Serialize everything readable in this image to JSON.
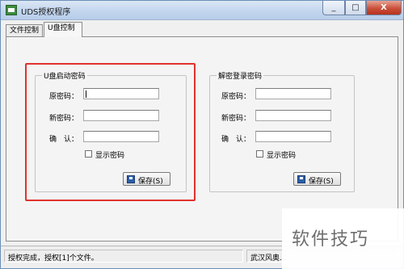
{
  "window": {
    "title": "UDS授权程序",
    "buttons": {
      "minimize": "_",
      "maximize": "□",
      "close": "X"
    }
  },
  "tabs": [
    {
      "label": "文件控制",
      "active": false
    },
    {
      "label": "U盘控制",
      "active": true
    }
  ],
  "usb_boot_password": {
    "title": "U盘启动密码",
    "old_label": "原密码：",
    "new_label": "新密码：",
    "confirm_label": "确　认：",
    "old_value": "",
    "new_value": "",
    "confirm_value": "",
    "show_password_label": "显示密码",
    "show_password_checked": false,
    "save_label": "保存(S)",
    "highlighted": true
  },
  "login_password": {
    "title": "解密登录密码",
    "old_label": "原密码：",
    "new_label": "新密码：",
    "confirm_label": "确　认：",
    "old_value": "",
    "new_value": "",
    "confirm_value": "",
    "show_password_label": "显示密码",
    "show_password_checked": false,
    "save_label": "保存(S)"
  },
  "statusbar": {
    "message": "授权完成，授权[1]个文件。",
    "company": "武汉风奥..."
  },
  "watermark": {
    "text": "软件技巧"
  },
  "colors": {
    "highlight": "#e0322d",
    "title_gradient": "#c3d6ee",
    "close_button": "#c9503b"
  }
}
